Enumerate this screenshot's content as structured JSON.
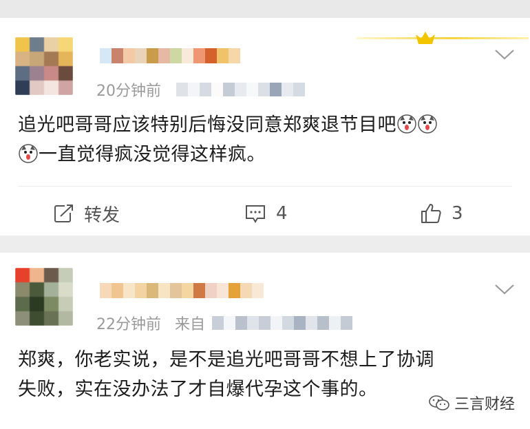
{
  "comments": [
    {
      "time": "20分钟前",
      "text_line1": "追光吧哥哥应该特别后悔没同意郑爽退节目吧",
      "text_line2": "一直觉得疯没觉得这样疯。",
      "actions": {
        "repost_label": "转发",
        "comment_count": "4",
        "like_count": "3"
      }
    },
    {
      "time": "22分钟前",
      "source_prefix": "来自",
      "text_line1": "郑爽，你老实说，是不是追光吧哥哥不想上了协调",
      "text_line2": "失败，实在没办法了才自爆代孕这个事的。"
    }
  ],
  "watermark": {
    "label": "三言财经"
  },
  "colors": {
    "text": "#1c1c1c",
    "meta": "#9a9a9a",
    "crown": "#f2c500"
  },
  "icons": [
    "chevron-down-icon",
    "crown-icon",
    "repost-icon",
    "comment-icon",
    "like-icon",
    "husky-emoji-icon",
    "wechat-icon"
  ]
}
